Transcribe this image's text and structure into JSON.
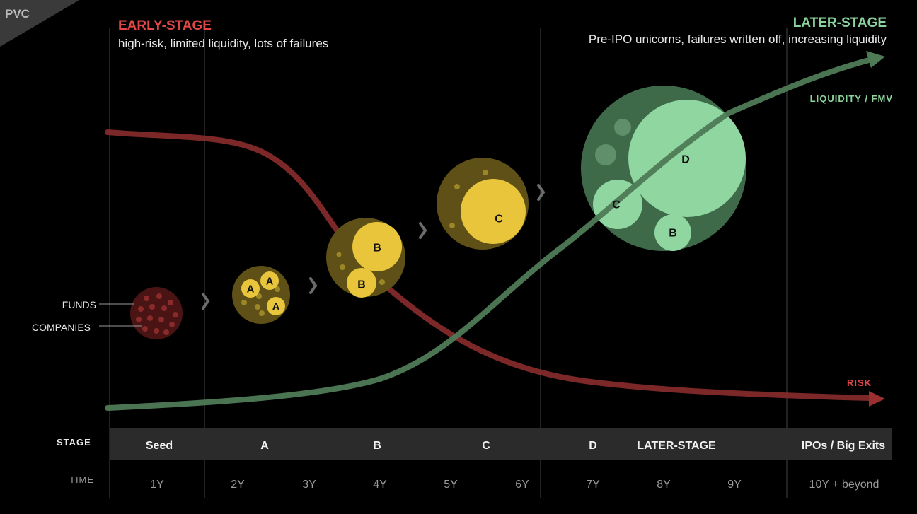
{
  "brand": {
    "logo_text": "PVC"
  },
  "early_stage": {
    "title": "EARLY-STAGE",
    "subtitle": "high-risk, limited liquidity, lots of failures"
  },
  "later_stage": {
    "title": "LATER-STAGE",
    "subtitle": "Pre-IPO unicorns, failures written off, increasing liquidity"
  },
  "labels": {
    "funds": "FUNDS",
    "companies": "COMPANIES",
    "stage": "STAGE",
    "time": "TIME"
  },
  "curves": {
    "liquidity": "LIQUIDITY / FMV",
    "risk": "RISK"
  },
  "colors": {
    "risk": "#8a2c2c",
    "liquidity": "#4e7a56",
    "early_bubble": "#e8c53a",
    "late_bubble": "#8fd6a0",
    "risk_text": "#e04848",
    "liquidity_text": "#8ad39c"
  },
  "bubbles": {
    "round_a": [
      "A",
      "A",
      "A"
    ],
    "round_b": [
      "B",
      "B"
    ],
    "round_c": [
      "C"
    ],
    "later": {
      "d": "D",
      "c": "C",
      "b": "B"
    }
  },
  "stages": [
    "Seed",
    "A",
    "B",
    "C",
    "D",
    "LATER-STAGE",
    "IPOs / Big Exits"
  ],
  "times": [
    "1Y",
    "2Y",
    "3Y",
    "4Y",
    "5Y",
    "6Y",
    "7Y",
    "8Y",
    "9Y",
    "10Y + beyond"
  ]
}
